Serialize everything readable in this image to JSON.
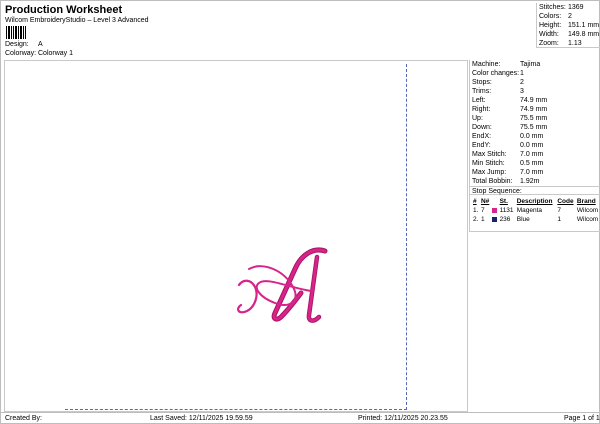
{
  "header": {
    "title": "Production Worksheet",
    "subtitle": "Wilcom EmbroideryStudio – Level 3 Advanced",
    "design_label": "Design:",
    "design_value": "A",
    "colorway_label": "Colorway:",
    "colorway_value": "Colorway 1"
  },
  "stats": [
    {
      "label": "Stitches:",
      "value": "1369"
    },
    {
      "label": "Colors:",
      "value": "2"
    },
    {
      "label": "Height:",
      "value": "151.1 mm"
    },
    {
      "label": "Width:",
      "value": "149.8 mm"
    },
    {
      "label": "Zoom:",
      "value": "1.13"
    }
  ],
  "info": [
    {
      "label": "Machine:",
      "value": "Tajima"
    },
    {
      "label": "Color changes:",
      "value": "1"
    },
    {
      "label": "Stops:",
      "value": "2"
    },
    {
      "label": "Trims:",
      "value": "3"
    },
    {
      "label": "Left:",
      "value": "74.9 mm"
    },
    {
      "label": "Right:",
      "value": "74.9 mm"
    },
    {
      "label": "Up:",
      "value": "75.5 mm"
    },
    {
      "label": "Down:",
      "value": "75.5 mm"
    },
    {
      "label": "EndX:",
      "value": "0.0 mm"
    },
    {
      "label": "EndY:",
      "value": "0.0 mm"
    },
    {
      "label": "Max Stitch:",
      "value": "7.0 mm"
    },
    {
      "label": "Min Stitch:",
      "value": "0.5 mm"
    },
    {
      "label": "Max Jump:",
      "value": "7.0 mm"
    },
    {
      "label": "Total Bobbin:",
      "value": "1.92m"
    }
  ],
  "stop_sequence": {
    "title": "Stop Sequence:",
    "columns": [
      "#",
      "N#",
      "St.",
      "Description",
      "Code",
      "Brand"
    ],
    "rows": [
      {
        "index": "1.",
        "needle": "7",
        "swatch": "#d6248c",
        "stitches": "1131",
        "description": "Magenta",
        "code": "7",
        "brand": "Wilcom"
      },
      {
        "index": "2.",
        "needle": "1",
        "swatch": "#1a2070",
        "stitches": "236",
        "description": "Blue",
        "code": "1",
        "brand": "Wilcom"
      }
    ]
  },
  "footer": {
    "created_by": "Created By:",
    "last_saved": "Last Saved: 12/11/2025 19.59.59",
    "printed": "Printed: 12/11/2025 20.23.55",
    "page": "Page 1 of 1"
  },
  "colors": {
    "design_thread": "#d6248c",
    "design_shadow": "#a8145f",
    "frame_line": "#5566bb"
  }
}
